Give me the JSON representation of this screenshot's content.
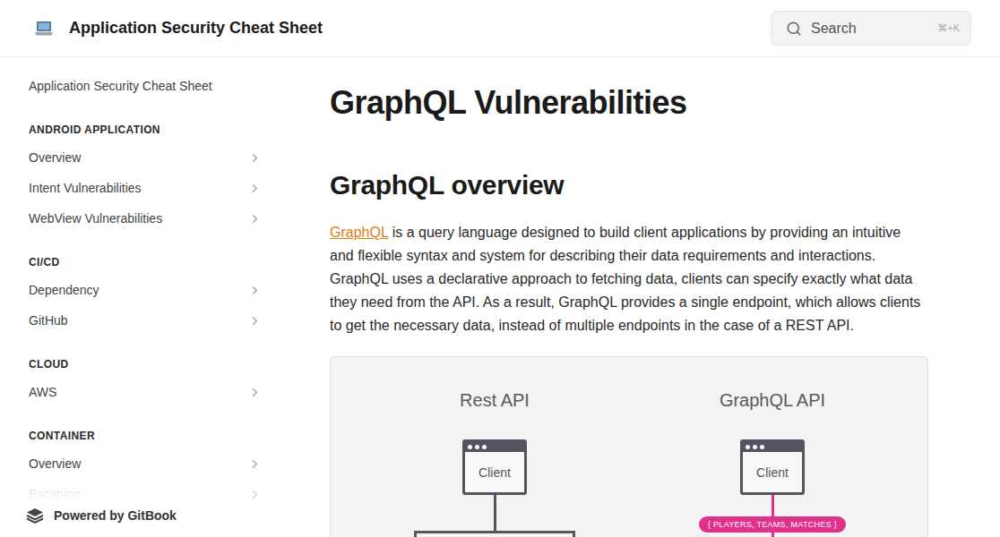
{
  "header": {
    "title": "Application Security Cheat Sheet",
    "search": {
      "placeholder": "Search",
      "shortcut": "⌘+K"
    }
  },
  "sidebar": {
    "top_item": "Application Security Cheat Sheet",
    "sections": [
      {
        "label": "ANDROID APPLICATION",
        "items": [
          {
            "label": "Overview",
            "faded": false
          },
          {
            "label": "Intent Vulnerabilities",
            "faded": false
          },
          {
            "label": "WebView Vulnerabilities",
            "faded": false
          }
        ]
      },
      {
        "label": "CI/CD",
        "items": [
          {
            "label": "Dependency",
            "faded": false
          },
          {
            "label": "GitHub",
            "faded": false
          }
        ]
      },
      {
        "label": "CLOUD",
        "items": [
          {
            "label": "AWS",
            "faded": false
          }
        ]
      },
      {
        "label": "CONTAINER",
        "items": [
          {
            "label": "Overview",
            "faded": false
          },
          {
            "label": "Escaping",
            "faded": true
          }
        ]
      }
    ],
    "footer": "Powered by GitBook"
  },
  "article": {
    "title": "GraphQL Vulnerabilities",
    "section_title": "GraphQL overview",
    "paragraph": [
      {
        "text": "GraphQL",
        "link": true
      },
      {
        "text": " is a query language designed to build client applications by providing an intuitive and flexible syntax and system for describing their data requirements and interactions. GraphQL uses a declarative approach to fetching data, clients can specify exactly what data they need from the API. As a result, GraphQL provides a single endpoint, which allows clients to get the necessary data, instead of multiple endpoints in the case of a REST API.",
        "link": false
      }
    ],
    "diagram": {
      "columns": [
        {
          "title": "Rest API",
          "client": "Client",
          "kind": "rest"
        },
        {
          "title": "GraphQL API",
          "client": "Client",
          "kind": "graphql",
          "tag": "{ PLAYERS, TEAMS, MATCHES }"
        }
      ]
    }
  }
}
